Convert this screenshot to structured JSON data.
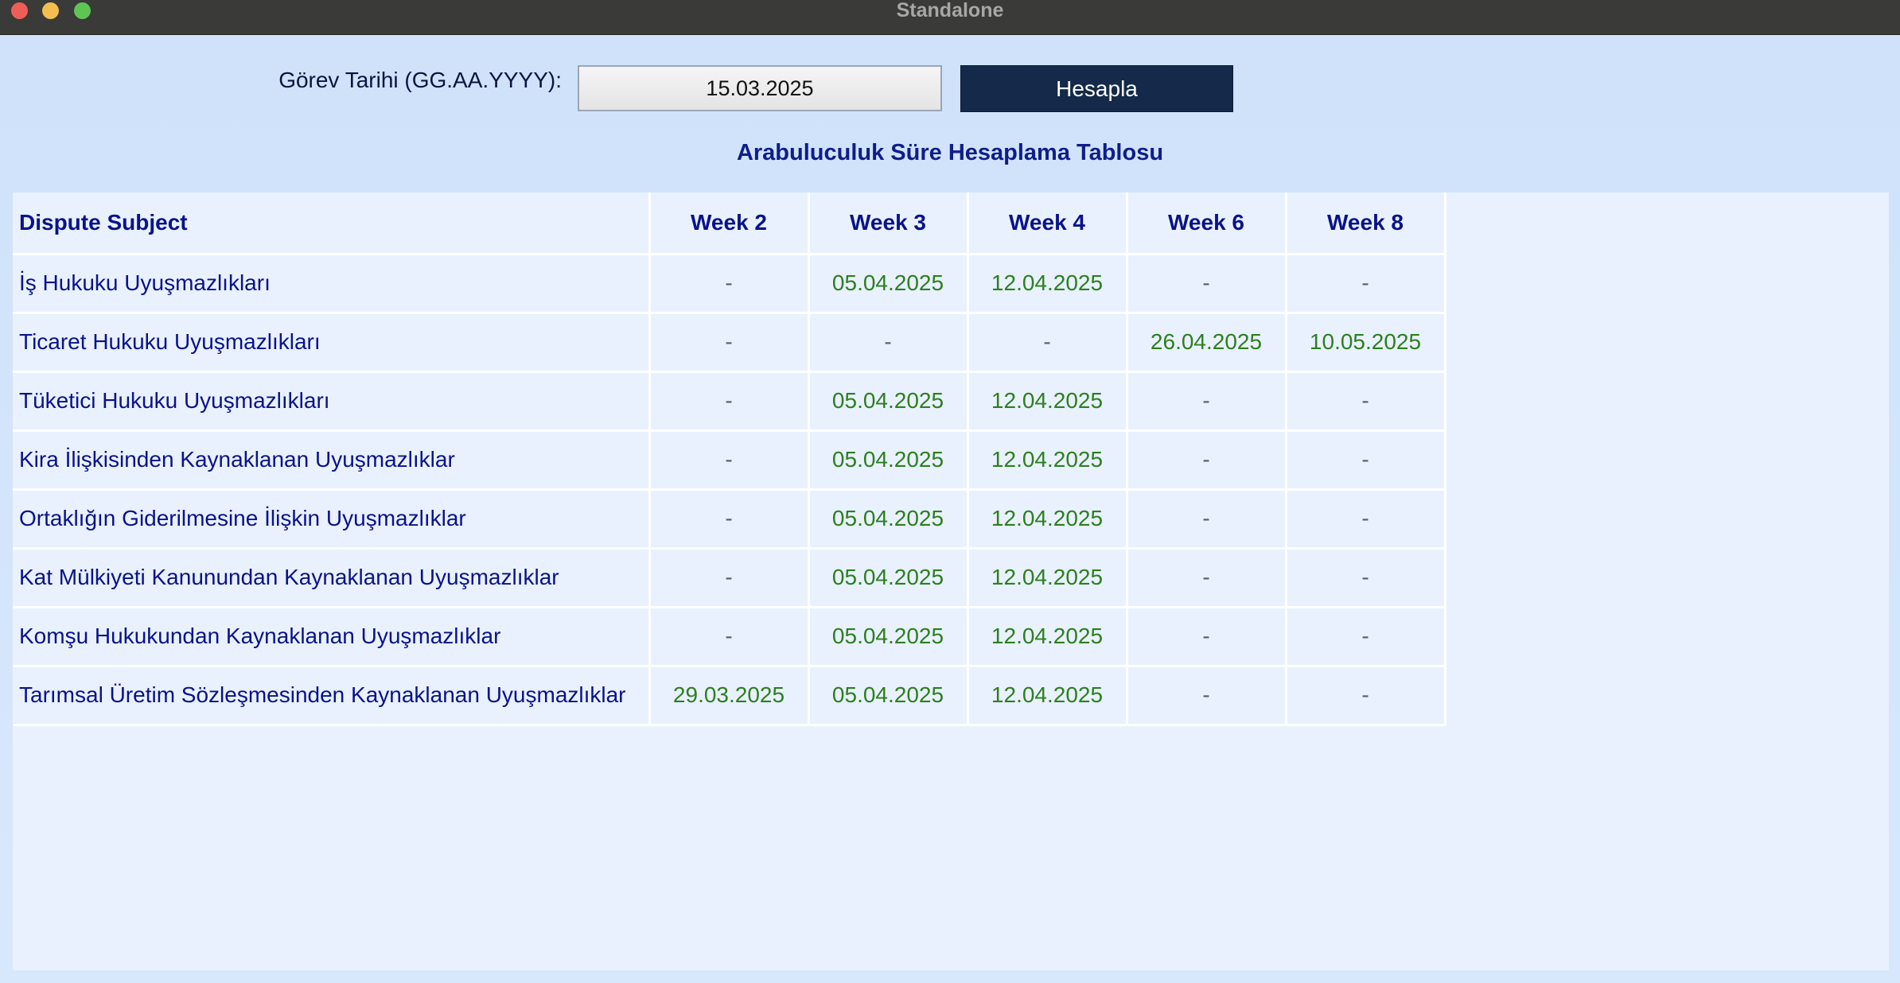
{
  "window": {
    "title": "Standalone"
  },
  "form": {
    "date_label": "Görev Tarihi (GG.AA.YYYY):",
    "date_value": "15.03.2025",
    "calculate_label": "Hesapla"
  },
  "table": {
    "title": "Arabuluculuk Süre Hesaplama Tablosu",
    "headers": [
      "Dispute Subject",
      "Week 2",
      "Week 3",
      "Week 4",
      "Week 6",
      "Week 8"
    ],
    "rows": [
      {
        "subject": "İş Hukuku Uyuşmazlıkları",
        "cells": [
          "-",
          "05.04.2025",
          "12.04.2025",
          "-",
          "-"
        ]
      },
      {
        "subject": "Ticaret Hukuku Uyuşmazlıkları",
        "cells": [
          "-",
          "-",
          "-",
          "26.04.2025",
          "10.05.2025"
        ]
      },
      {
        "subject": "Tüketici Hukuku Uyuşmazlıkları",
        "cells": [
          "-",
          "05.04.2025",
          "12.04.2025",
          "-",
          "-"
        ]
      },
      {
        "subject": "Kira İlişkisinden Kaynaklanan Uyuşmazlıklar",
        "cells": [
          "-",
          "05.04.2025",
          "12.04.2025",
          "-",
          "-"
        ]
      },
      {
        "subject": "Ortaklığın Giderilmesine İlişkin Uyuşmazlıklar",
        "cells": [
          "-",
          "05.04.2025",
          "12.04.2025",
          "-",
          "-"
        ]
      },
      {
        "subject": "Kat Mülkiyeti Kanunundan Kaynaklanan Uyuşmazlıklar",
        "cells": [
          "-",
          "05.04.2025",
          "12.04.2025",
          "-",
          "-"
        ]
      },
      {
        "subject": "Komşu Hukukundan Kaynaklanan Uyuşmazlıklar",
        "cells": [
          "-",
          "05.04.2025",
          "12.04.2025",
          "-",
          "-"
        ]
      },
      {
        "subject": "Tarımsal Üretim Sözleşmesinden Kaynaklanan Uyuşmazlıklar",
        "cells": [
          "29.03.2025",
          "05.04.2025",
          "12.04.2025",
          "-",
          "-"
        ]
      }
    ]
  },
  "colors": {
    "header_text": "#0a128c",
    "date_text": "#2d7f1f",
    "dash_text": "#54606c",
    "button_bg": "#152a4a",
    "background": "#d2e4fb"
  }
}
